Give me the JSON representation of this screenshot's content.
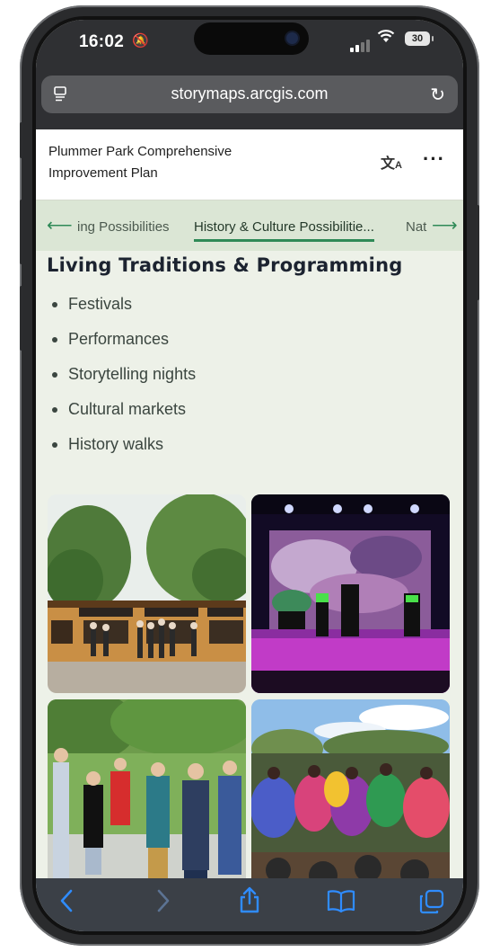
{
  "status_bar": {
    "time": "16:02",
    "battery": "30"
  },
  "browser": {
    "url": "storymaps.arcgis.com"
  },
  "story": {
    "title_line1": "Plummer Park Comprehensive",
    "title_line2": "Improvement Plan"
  },
  "nav": {
    "prev_item": "ing Possibilities",
    "active_item": "History & Culture Possibilitie...",
    "next_item": "Nat"
  },
  "section": {
    "heading": "Living Traditions & Programming",
    "bullets": [
      "Festivals",
      "Performances",
      "Storytelling nights",
      "Cultural markets",
      "History walks"
    ]
  },
  "icons": {
    "tabs": "tabs-icon",
    "reload": "reload-icon",
    "translate": "translate-icon",
    "more": "more-icon",
    "back": "back-icon",
    "forward": "forward-icon",
    "share": "share-icon",
    "bookmarks": "bookmarks-icon",
    "tab_overview": "tabs-overview-icon"
  },
  "colors": {
    "accent_green": "#2f8a57",
    "content_bg": "#edf1e8",
    "nav_bg": "#dbe6d5",
    "browser_chrome": "#2f3033",
    "toolbar_blue": "#2f8cff"
  }
}
